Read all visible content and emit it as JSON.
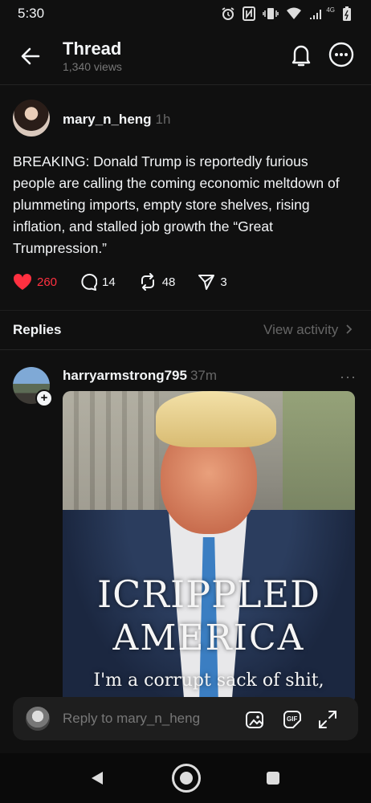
{
  "status_bar": {
    "time": "5:30",
    "network_label": "4G",
    "icons": [
      "alarm-icon",
      "nfc-icon",
      "vibrate-icon",
      "wifi-icon",
      "signal-icon",
      "battery-icon"
    ]
  },
  "header": {
    "title": "Thread",
    "views": "1,340 views"
  },
  "post": {
    "username": "mary_n_heng",
    "time": "1h",
    "text": "BREAKING: Donald Trump is reportedly furious people are calling the coming economic meltdown of plummeting imports, empty store shelves, rising inflation, and stalled job growth the “Great Trumpression.”",
    "likes": "260",
    "comments": "14",
    "reposts": "48",
    "shares": "3"
  },
  "replies_bar": {
    "title": "Replies",
    "view_activity": "View activity"
  },
  "reply": {
    "username": "harryarmstrong795",
    "time": "37m",
    "plus": "+",
    "more": "···",
    "image_text": {
      "line1": "ICRIPPLED",
      "line2": "AMERICA",
      "line3": "I'm a corrupt sack of shit,"
    }
  },
  "composer": {
    "placeholder": "Reply to mary_n_heng"
  },
  "colors": {
    "background": "#101010",
    "like": "#ff3040",
    "muted": "#777777"
  }
}
